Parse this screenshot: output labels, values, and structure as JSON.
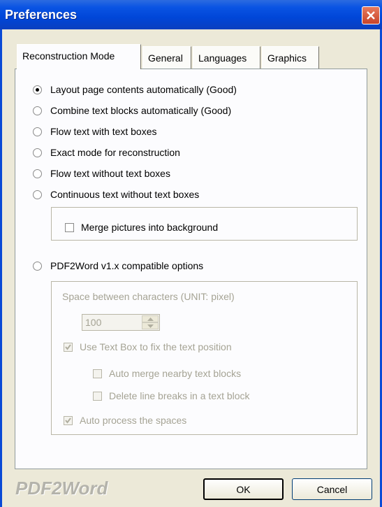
{
  "window": {
    "title": "Preferences"
  },
  "tabs": [
    {
      "label": "Reconstruction Mode",
      "active": true
    },
    {
      "label": "General",
      "active": false
    },
    {
      "label": "Languages",
      "active": false
    },
    {
      "label": "Graphics",
      "active": false
    }
  ],
  "modes": [
    {
      "label": "Layout page contents automatically (Good)",
      "checked": true
    },
    {
      "label": "Combine text blocks automatically (Good)",
      "checked": false
    },
    {
      "label": "Flow text with text boxes",
      "checked": false
    },
    {
      "label": "Exact mode for reconstruction",
      "checked": false
    },
    {
      "label": "Flow text without text boxes",
      "checked": false
    },
    {
      "label": "Continuous text without text boxes",
      "checked": false
    }
  ],
  "merge_pictures": {
    "label": "Merge pictures into background",
    "checked": false
  },
  "pdf2word_compat": {
    "label": "PDF2Word v1.x compatible options",
    "checked": false
  },
  "spacing": {
    "label": "Space between characters (UNIT: pixel)",
    "value": "100"
  },
  "options": {
    "use_text_box": {
      "label": "Use Text Box to fix the text position",
      "checked": true
    },
    "auto_merge": {
      "label": "Auto merge nearby text blocks",
      "checked": false
    },
    "delete_breaks": {
      "label": "Delete line breaks in a text block",
      "checked": false
    },
    "auto_process": {
      "label": "Auto process the spaces",
      "checked": true
    }
  },
  "footer": {
    "logo": "PDF2Word",
    "ok_label": "OK",
    "cancel_label": "Cancel"
  },
  "colors": {
    "titlebar": "#0046d8",
    "close_button": "#c8442a",
    "dialog_bg": "#ece9d8",
    "disabled_text": "#a5a394"
  },
  "icons": {
    "close": "close-icon",
    "spin_up": "spin-up-icon",
    "spin_down": "spin-down-icon",
    "checkmark": "checkmark-icon"
  }
}
